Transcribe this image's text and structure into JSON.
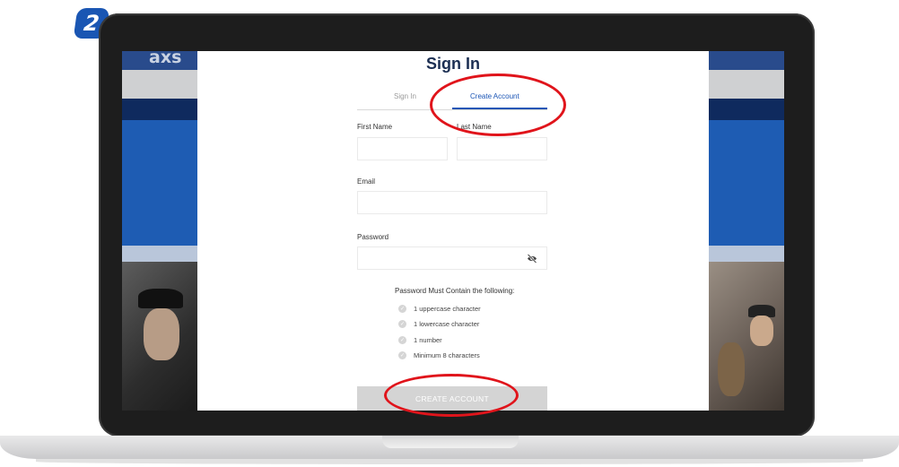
{
  "step_number": "2",
  "background_page": {
    "logo": "axs"
  },
  "modal": {
    "title": "Sign In",
    "tabs": {
      "sign_in": "Sign In",
      "create_account": "Create Account"
    },
    "fields": {
      "first_name_label": "First Name",
      "last_name_label": "Last Name",
      "email_label": "Email",
      "password_label": "Password"
    },
    "requirements": {
      "title": "Password Must Contain the following:",
      "items": [
        "1 uppercase character",
        "1 lowercase character",
        "1 number",
        "Minimum 8 characters"
      ]
    },
    "submit_label": "CREATE ACCOUNT"
  },
  "colors": {
    "accent": "#1b55b5",
    "highlight_ring": "#e0141b",
    "brand_navy": "#0f2a5e",
    "brand_blue": "#1e5cb3"
  }
}
